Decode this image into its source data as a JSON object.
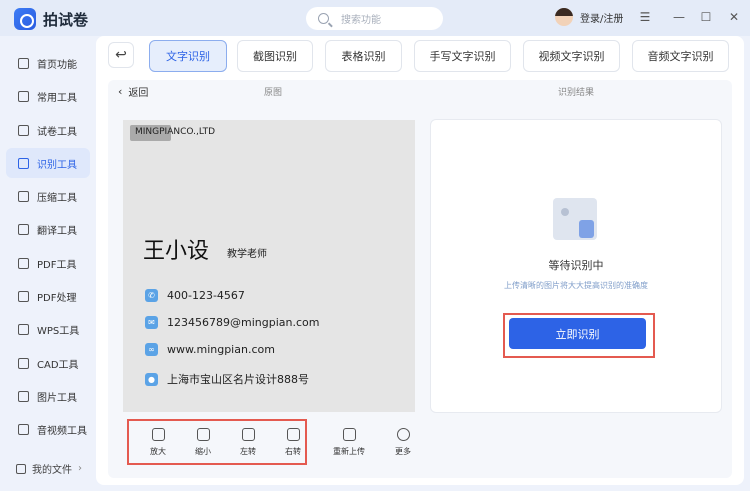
{
  "app": {
    "name": "拍试卷"
  },
  "search": {
    "placeholder": "搜索功能"
  },
  "user": {
    "login_label": "登录/注册"
  },
  "window": {
    "menu": "☰",
    "minimize": "—",
    "maximize": "☐",
    "close": "✕"
  },
  "sidebar": {
    "items": [
      {
        "label": "首页功能",
        "icon": "home-icon"
      },
      {
        "label": "常用工具",
        "icon": "layers-icon"
      },
      {
        "label": "试卷工具",
        "icon": "exam-icon"
      },
      {
        "label": "识别工具",
        "icon": "scan-icon",
        "active": true
      },
      {
        "label": "压缩工具",
        "icon": "compress-icon"
      },
      {
        "label": "翻译工具",
        "icon": "translate-icon"
      },
      {
        "label": "PDF工具",
        "icon": "pdf-icon"
      },
      {
        "label": "PDF处理",
        "icon": "pdf-process-icon"
      },
      {
        "label": "WPS工具",
        "icon": "wps-icon"
      },
      {
        "label": "CAD工具",
        "icon": "cad-icon"
      },
      {
        "label": "图片工具",
        "icon": "image-icon"
      },
      {
        "label": "音视频工具",
        "icon": "media-icon"
      }
    ],
    "my_files": "我的文件"
  },
  "tabs": [
    {
      "label": "文字识别",
      "active": true
    },
    {
      "label": "截图识别"
    },
    {
      "label": "表格识别"
    },
    {
      "label": "手写文字识别"
    },
    {
      "label": "视频文字识别"
    },
    {
      "label": "音频文字识别"
    }
  ],
  "content": {
    "back": "返回",
    "original_title": "原图",
    "result_title": "识别结果"
  },
  "card": {
    "company": "MINGPIANCO.,LTD",
    "name": "王小设",
    "role": "教学老师",
    "phone": "400-123-4567",
    "email": "123456789@mingpian.com",
    "website": "www.mingpian.com",
    "address": "上海市宝山区名片设计888号"
  },
  "tools": [
    {
      "label": "放大",
      "icon": "zoom-in-icon"
    },
    {
      "label": "缩小",
      "icon": "zoom-out-icon"
    },
    {
      "label": "左转",
      "icon": "rotate-left-icon"
    },
    {
      "label": "右转",
      "icon": "rotate-right-icon"
    },
    {
      "label": "重新上传",
      "icon": "reupload-icon"
    },
    {
      "label": "更多",
      "icon": "more-icon"
    }
  ],
  "result": {
    "status": "等待识别中",
    "hint": "上传清晰的图片将大大提高识别的准确度",
    "button": "立即识别"
  },
  "colors": {
    "accent": "#2d63e6",
    "highlight_frame": "#e45a50"
  }
}
